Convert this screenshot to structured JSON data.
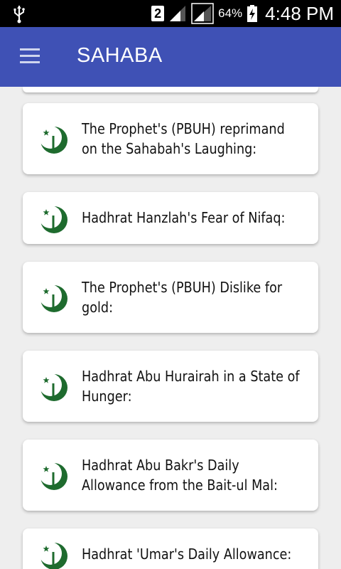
{
  "status_bar": {
    "sim_slot": "2",
    "battery_percent": "64%",
    "time": "4:48 PM"
  },
  "app_bar": {
    "title": "SAHABA"
  },
  "items": [
    {
      "line1": "The Prophet's (PBUH) reprimand",
      "line2": "on the Sahabah's Laughing:"
    },
    {
      "line1": "Hadhrat Hanzlah's Fear of Nifaq:",
      "line2": ""
    },
    {
      "line1": "The Prophet's (PBUH) Dislike for",
      "line2": "gold:"
    },
    {
      "line1": "Hadhrat Abu Hurairah in a State of",
      "line2": "Hunger:"
    },
    {
      "line1": "Hadhrat Abu Bakr's Daily",
      "line2": "Allowance from the Bait-ul Mal:"
    },
    {
      "line1": "Hadhrat 'Umar's Daily Allowance:",
      "line2": ""
    }
  ],
  "colors": {
    "app_bar": "#3f51b5",
    "icon_green": "#1e6b2e"
  }
}
